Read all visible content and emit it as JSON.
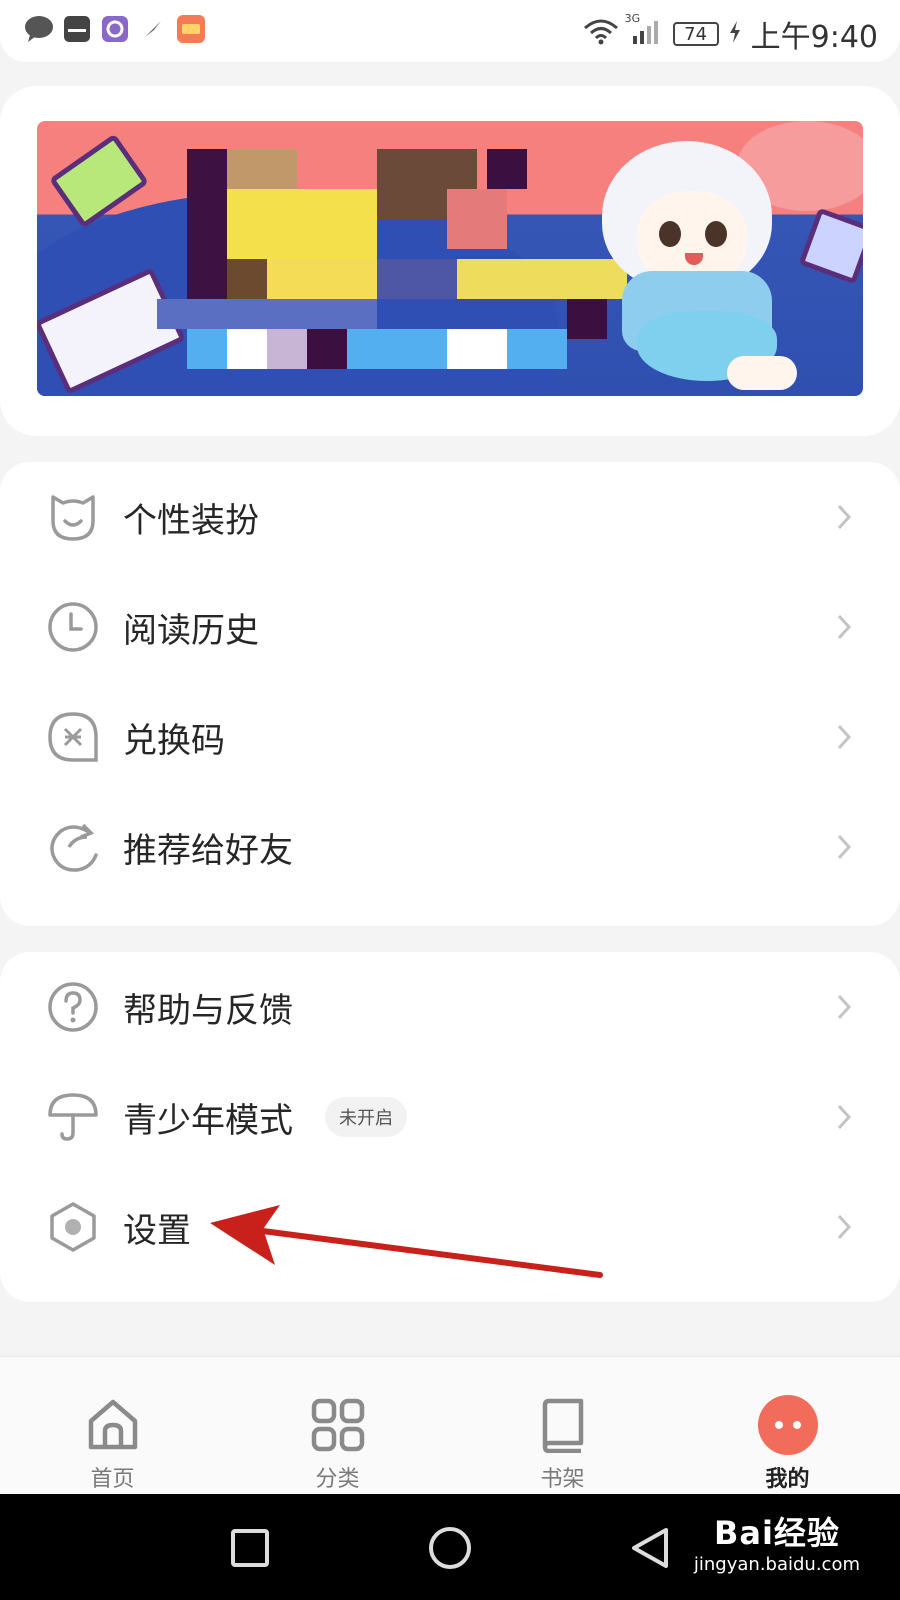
{
  "status_bar": {
    "network": "3G",
    "battery": "74",
    "time": "上午9:40",
    "notification_icons": [
      "message-icon",
      "huawei-store-icon",
      "app-icon",
      "compass-icon",
      "huawei-app-icon"
    ]
  },
  "banner": {
    "description_icon": "promo-banner-image"
  },
  "menu_group_1": [
    {
      "label": "个性装扮",
      "icon": "cat-face-icon"
    },
    {
      "label": "阅读历史",
      "icon": "clock-icon"
    },
    {
      "label": "兑换码",
      "icon": "coupon-icon"
    },
    {
      "label": "推荐给好友",
      "icon": "share-arrow-icon"
    }
  ],
  "menu_group_2": [
    {
      "label": "帮助与反馈",
      "icon": "question-icon"
    },
    {
      "label": "青少年模式",
      "icon": "umbrella-icon",
      "badge": "未开启"
    },
    {
      "label": "设置",
      "icon": "hexagon-settings-icon"
    }
  ],
  "bottom_nav": [
    {
      "label": "首页",
      "icon": "home-icon",
      "active": false
    },
    {
      "label": "分类",
      "icon": "grid-icon",
      "active": false
    },
    {
      "label": "书架",
      "icon": "bookshelf-icon",
      "active": false
    },
    {
      "label": "我的",
      "icon": "profile-face-icon",
      "active": true
    }
  ],
  "watermark": {
    "logo": "Bai经验",
    "url": "jingyan.baidu.com"
  },
  "colors": {
    "accent": "#f26c5c",
    "annotation_arrow": "#c8201a",
    "icon_gray": "#9a9a9a"
  }
}
